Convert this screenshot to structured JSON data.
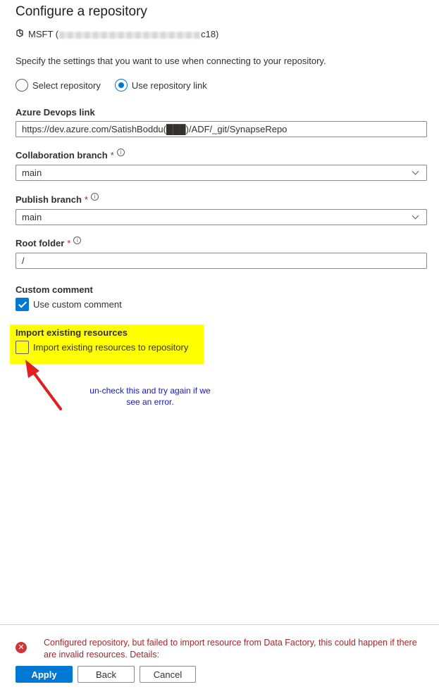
{
  "page": {
    "title": "Configure a repository",
    "subscription_prefix": "MSFT (",
    "subscription_suffix": "c18)",
    "description": "Specify the settings that you want to use when connecting to your repository."
  },
  "repo_mode": {
    "options": [
      {
        "label": "Select repository",
        "selected": false
      },
      {
        "label": "Use repository link",
        "selected": true
      }
    ]
  },
  "devops_link": {
    "label": "Azure Devops link",
    "value": "https://dev.azure.com/SatishBoddu(███)/ADF/_git/SynapseRepo"
  },
  "collab_branch": {
    "label": "Collaboration branch",
    "required": "*",
    "value": "main"
  },
  "publish_branch": {
    "label": "Publish branch",
    "required": "*",
    "value": "main"
  },
  "root_folder": {
    "label": "Root folder",
    "required": "*",
    "value": "/"
  },
  "custom_comment": {
    "section": "Custom comment",
    "checkbox_label": "Use custom comment",
    "checked": true
  },
  "import_resources": {
    "section": "Import existing resources",
    "checkbox_label": "Import existing resources to repository",
    "checked": false
  },
  "annotation": {
    "line1": "un-check this and try again if we",
    "line2": "see an error."
  },
  "error": {
    "message": "Configured repository, but failed to import resource from Data Factory, this could happen if there are invalid resources. Details:"
  },
  "buttons": {
    "apply": "Apply",
    "back": "Back",
    "cancel": "Cancel"
  },
  "colors": {
    "accent": "#0078d4",
    "error": "#a4262c",
    "highlight": "#ffff00",
    "annotation_text": "#1515d6",
    "arrow": "#e02020"
  }
}
